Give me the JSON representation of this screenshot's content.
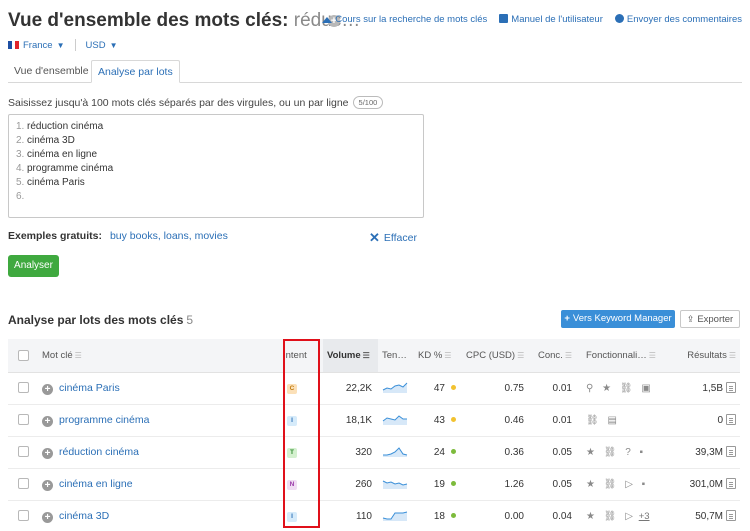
{
  "header": {
    "title_prefix": "Vue d'ensemble des mots clés:",
    "title_query": "réduc…",
    "links": [
      {
        "label": "Cours sur la recherche de mots clés",
        "icon": "graduation-cap-icon"
      },
      {
        "label": "Manuel de l'utilisateur",
        "icon": "book-icon"
      },
      {
        "label": "Envoyer des commentaires",
        "icon": "chat-bubble-icon"
      }
    ]
  },
  "locale": {
    "country": "France",
    "currency": "USD"
  },
  "tabs": [
    {
      "label": "Vue d'ensemble"
    },
    {
      "label": "Analyse par lots"
    }
  ],
  "input": {
    "instruction": "Saisissez jusqu'à 100 mots clés séparés par des virgules, ou un par ligne",
    "counter": "5/100",
    "lines": [
      "réduction cinéma",
      "cinéma 3D",
      "cinéma en ligne",
      "programme cinéma",
      "cinéma Paris",
      ""
    ]
  },
  "examples": {
    "label": "Exemples gratuits:",
    "link": "buy books, loans, movies",
    "clear_label": "Effacer"
  },
  "analyze_label": "Analyser",
  "results": {
    "title": "Analyse par lots des mots clés",
    "count": "5",
    "km_button": "Vers Keyword Manager",
    "export_button": "Exporter",
    "columns": {
      "keyword": "Mot clé",
      "intent": "Intent",
      "volume": "Volume",
      "trend": "Ten…",
      "kd": "KD %",
      "cpc": "CPC (USD)",
      "conc": "Conc.",
      "features": "Fonctionnali…",
      "results": "Résultats"
    },
    "rows": [
      {
        "keyword": "cinéma Paris",
        "intent": "C",
        "volume": "22,2K",
        "kd": "47",
        "cpc": "0.75",
        "conc": "0.01",
        "features": "⚲ ★ ⛓ ▣",
        "more": "",
        "results": "1,5B"
      },
      {
        "keyword": "programme cinéma",
        "intent": "I",
        "volume": "18,1K",
        "kd": "43",
        "cpc": "0.46",
        "conc": "0.01",
        "features": "⛓ ▤",
        "more": "",
        "results": "0"
      },
      {
        "keyword": "réduction cinéma",
        "intent": "T",
        "volume": "320",
        "kd": "24",
        "cpc": "0.36",
        "conc": "0.05",
        "features": "★ ⛓ ? ▪",
        "more": "",
        "results": "39,3M"
      },
      {
        "keyword": "cinéma en ligne",
        "intent": "N",
        "volume": "260",
        "kd": "19",
        "cpc": "1.26",
        "conc": "0.05",
        "features": "★ ⛓ ▷ ▪",
        "more": "",
        "results": "301,0M"
      },
      {
        "keyword": "cinéma 3D",
        "intent": "I",
        "volume": "110",
        "kd": "18",
        "cpc": "0.00",
        "conc": "0.04",
        "features": "★ ⛓ ▷",
        "more": "+3",
        "results": "50,7M"
      }
    ]
  },
  "colors": {
    "link": "#2b6fb6",
    "analyze_green": "#3fa93f",
    "km_blue": "#3a8fd8",
    "highlight_red": "#e0101a",
    "kd_yellow": "#f2c230",
    "kd_green": "#7dbb3c",
    "intent_C": "#fbe0b8",
    "intent_I": "#d6ebfa",
    "intent_T": "#d4f0cf",
    "intent_N": "#f0dcf3"
  }
}
